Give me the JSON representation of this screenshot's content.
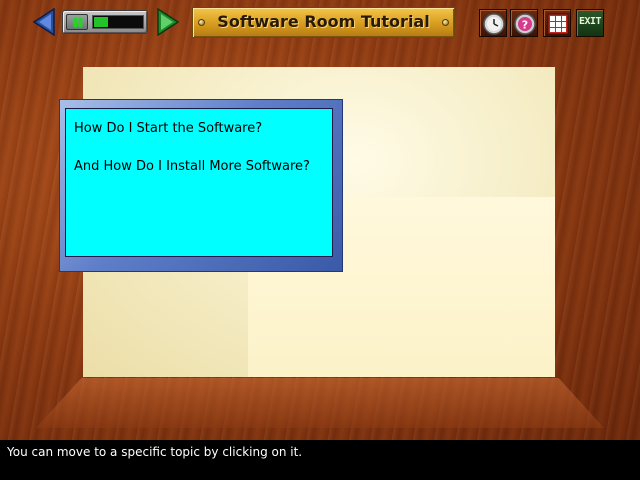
{
  "toolbar": {
    "title": "Software Room Tutorial",
    "exit_label": "EXIT",
    "volume_level": 0.3,
    "icons": {
      "back": "left-arrow-icon",
      "forward": "right-arrow-icon",
      "pause": "pause-icon",
      "clock": "clock-icon",
      "help": "help-icon",
      "menu": "grid-menu-icon"
    }
  },
  "topics": [
    {
      "label": "How Do I Start the Software?"
    },
    {
      "label": "And How Do I Install More Software?"
    }
  ],
  "status": {
    "text": "You can move to a specific topic by clicking on it."
  },
  "colors": {
    "card_background": "#00ffff",
    "title_plate": "#d79c1e",
    "wood": "#8e3a12"
  }
}
